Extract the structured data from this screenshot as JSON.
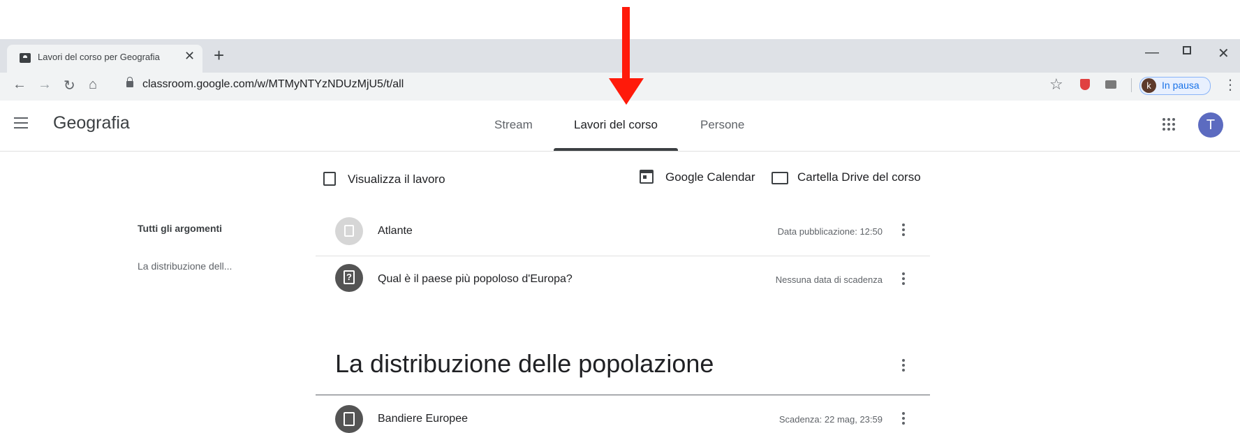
{
  "browser": {
    "tab_title": "Lavori del corso per Geografia",
    "url": "classroom.google.com/w/MTMyNTYzNDUzMjU5/t/all",
    "profile_initial": "k",
    "profile_status": "In pausa"
  },
  "header": {
    "class_name": "Geografia",
    "tabs": [
      {
        "label": "Stream"
      },
      {
        "label": "Lavori del corso"
      },
      {
        "label": "Persone"
      }
    ],
    "active_tab": "Lavori del corso",
    "user_initial": "T"
  },
  "toolbar": {
    "view_work": "Visualizza il lavoro",
    "calendar": "Google Calendar",
    "drive": "Cartella Drive del corso"
  },
  "topics_sidebar": {
    "all": "Tutti gli argomenti",
    "items": [
      "La distribuzione dell..."
    ]
  },
  "items": [
    {
      "title": "Atlante",
      "meta": "Data pubblicazione: 12:50",
      "icon": "material-icon"
    },
    {
      "title": "Qual è il paese più popoloso d'Europa?",
      "meta": "Nessuna data di scadenza",
      "icon": "question-icon"
    }
  ],
  "topic": {
    "title": "La distribuzione delle popolazione",
    "items": [
      {
        "title": "Bandiere Europee",
        "meta": "Scadenza: 22 mag, 23:59",
        "icon": "assignment-icon"
      }
    ]
  },
  "colors": {
    "annotation_arrow": "#ff1a0a",
    "avatar": "#5c6bc0",
    "active_tab_indicator": "#3c4043"
  }
}
